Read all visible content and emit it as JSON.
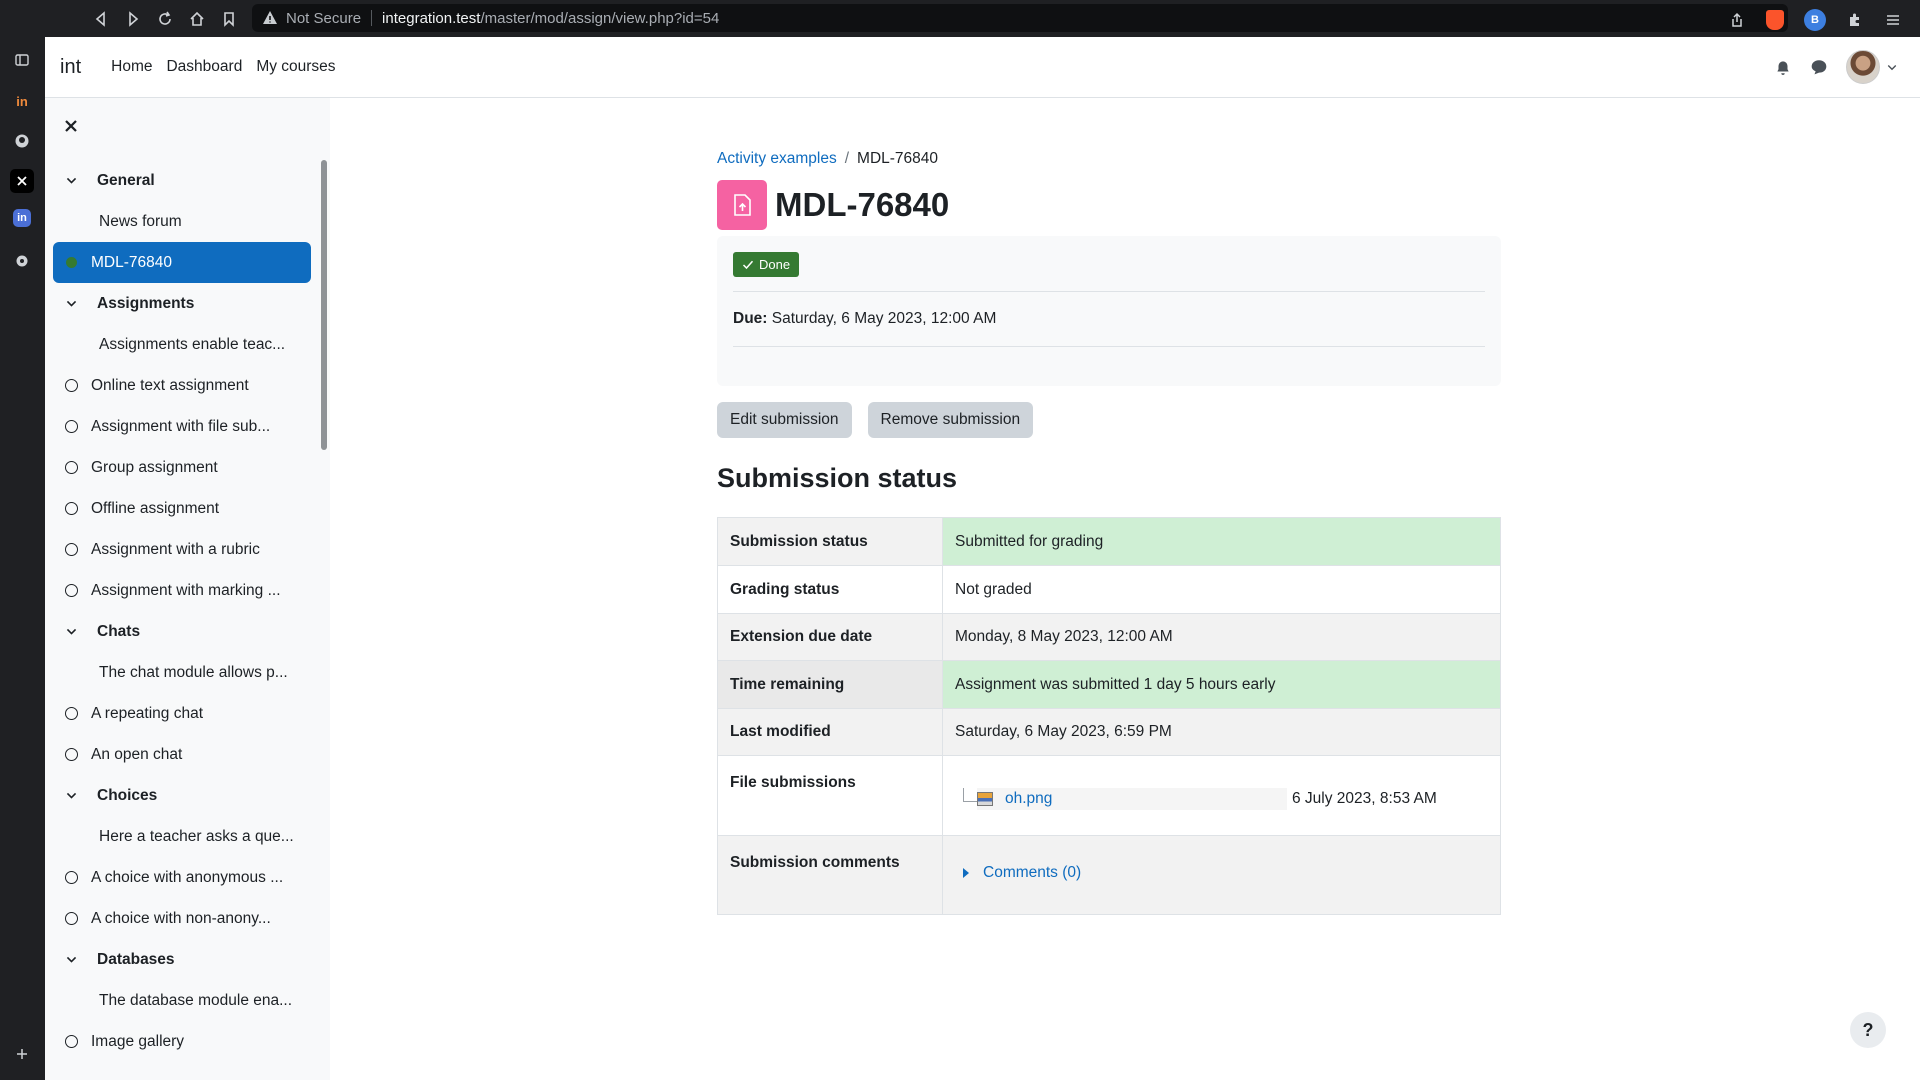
{
  "browser": {
    "security_label": "Not Secure",
    "url_host": "integration.test",
    "url_path": "/master/mod/assign/view.php?id=54",
    "extension_badge": "B"
  },
  "rail": {
    "items": [
      {
        "name": "sidebar-toggle-icon"
      },
      {
        "name": "app-in-orange",
        "text": "in"
      },
      {
        "name": "github-icon"
      },
      {
        "name": "close-icon"
      },
      {
        "name": "app-in-blue",
        "text": "in"
      },
      {
        "name": "settings-icon"
      }
    ]
  },
  "navbar": {
    "brand": "int",
    "links": [
      "Home",
      "Dashboard",
      "My courses"
    ]
  },
  "course_index": {
    "items": [
      {
        "type": "section",
        "label": "General"
      },
      {
        "type": "activity",
        "label": "News forum",
        "completion": false
      },
      {
        "type": "active",
        "label": "MDL-76840"
      },
      {
        "type": "section",
        "label": "Assignments"
      },
      {
        "type": "activity",
        "label": "Assignments enable teac...",
        "completion": false
      },
      {
        "type": "activity",
        "label": "Online text assignment",
        "completion": true
      },
      {
        "type": "activity",
        "label": "Assignment with file sub...",
        "completion": true
      },
      {
        "type": "activity",
        "label": "Group assignment",
        "completion": true
      },
      {
        "type": "activity",
        "label": "Offline assignment",
        "completion": true
      },
      {
        "type": "activity",
        "label": "Assignment with a rubric",
        "completion": true
      },
      {
        "type": "activity",
        "label": "Assignment with marking ...",
        "completion": true
      },
      {
        "type": "section",
        "label": "Chats"
      },
      {
        "type": "activity",
        "label": "The chat module allows p...",
        "completion": false
      },
      {
        "type": "activity",
        "label": "A repeating chat",
        "completion": true
      },
      {
        "type": "activity",
        "label": "An open chat",
        "completion": true
      },
      {
        "type": "section",
        "label": "Choices"
      },
      {
        "type": "activity",
        "label": "Here a teacher asks a que...",
        "completion": false
      },
      {
        "type": "activity",
        "label": "A choice with anonymous ...",
        "completion": true
      },
      {
        "type": "activity",
        "label": "A choice with non-anony...",
        "completion": true
      },
      {
        "type": "section",
        "label": "Databases"
      },
      {
        "type": "activity",
        "label": "The database module ena...",
        "completion": false
      },
      {
        "type": "activity",
        "label": "Image gallery",
        "completion": true
      }
    ]
  },
  "breadcrumb": {
    "parent": "Activity examples",
    "current": "MDL-76840"
  },
  "page": {
    "title": "MDL-76840",
    "done_label": "Done",
    "due_label": "Due:",
    "due_value": "Saturday, 6 May 2023, 12:00 AM",
    "edit_button": "Edit submission",
    "remove_button": "Remove submission",
    "status_heading": "Submission status"
  },
  "status_table": {
    "submission_status": {
      "label": "Submission status",
      "value": "Submitted for grading"
    },
    "grading_status": {
      "label": "Grading status",
      "value": "Not graded"
    },
    "extension_due_date": {
      "label": "Extension due date",
      "value": "Monday, 8 May 2023, 12:00 AM"
    },
    "time_remaining": {
      "label": "Time remaining",
      "value": "Assignment was submitted 1 day 5 hours early"
    },
    "last_modified": {
      "label": "Last modified",
      "value": "Saturday, 6 May 2023, 6:59 PM"
    },
    "file_submissions": {
      "label": "File submissions",
      "file_name": "oh.png",
      "file_date": "6 July 2023, 8:53 AM"
    },
    "submission_comments": {
      "label": "Submission comments",
      "link": "Comments (0)"
    }
  },
  "help_button": "?"
}
